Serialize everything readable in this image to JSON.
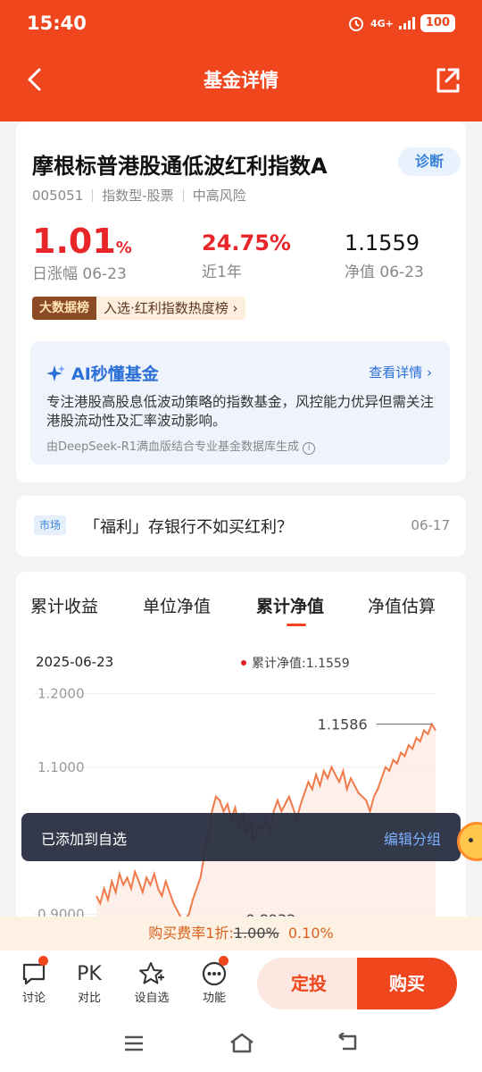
{
  "status": {
    "time": "15:40",
    "network": "4G+",
    "battery": "100"
  },
  "header": {
    "title": "基金详情"
  },
  "fund": {
    "name": "摩根标普港股通低波红利指数A",
    "diagnose_label": "诊断",
    "code": "005051",
    "type": "指数型-股票",
    "risk": "中高风险",
    "daily_change": "1.01",
    "daily_change_unit": "%",
    "daily_change_label": "日涨幅 06-23",
    "year_return": "24.75%",
    "year_return_label": "近1年",
    "nav": "1.1559",
    "nav_label": "净值 06-23",
    "rank_tag": "大数据榜",
    "rank_text": "入选·红利指数热度榜"
  },
  "ai": {
    "title": "AI秒懂基金",
    "more": "查看详情",
    "body": "专注港股高股息低波动策略的指数基金，风控能力优异但需关注港股流动性及汇率波动影响。",
    "footer": "由DeepSeek-R1满血版结合专业基金数据库生成"
  },
  "news": {
    "tag": "市场",
    "title": "「福利」存银行不如买红利？",
    "date": "06-17"
  },
  "tabs": [
    "累计收益",
    "单位净值",
    "累计净值",
    "净值估算"
  ],
  "active_tab": 2,
  "chart_meta": {
    "date": "2025-06-23",
    "legend": "累计净值:1.1559",
    "legend_color": "#e02020",
    "line_color": "#f07a4a"
  },
  "chart_data": {
    "type": "line",
    "ylim": [
      0.88,
      1.22
    ],
    "yticks": [
      "1.2000",
      "1.1000",
      "0.9000"
    ],
    "ytick_values": [
      1.2,
      1.1,
      0.9
    ],
    "series": [
      {
        "name": "累计净值",
        "values": [
          0.925,
          0.915,
          0.935,
          0.92,
          0.945,
          0.93,
          0.955,
          0.94,
          0.95,
          0.935,
          0.958,
          0.945,
          0.93,
          0.95,
          0.94,
          0.955,
          0.935,
          0.925,
          0.945,
          0.93,
          0.915,
          0.905,
          0.895,
          0.8932,
          0.9,
          0.92,
          0.935,
          0.95,
          0.98,
          1.01,
          1.04,
          1.06,
          1.055,
          1.04,
          1.05,
          1.03,
          1.045,
          1.02,
          1.035,
          1.01,
          1.03,
          1.0,
          1.02,
          1.015,
          1.03,
          1.01,
          1.04,
          1.055,
          1.04,
          1.05,
          1.06,
          1.045,
          1.03,
          1.05,
          1.065,
          1.08,
          1.07,
          1.09,
          1.075,
          1.095,
          1.085,
          1.1,
          1.09,
          1.08,
          1.095,
          1.07,
          1.085,
          1.075,
          1.065,
          1.06,
          1.055,
          1.04,
          1.06,
          1.07,
          1.085,
          1.1,
          1.095,
          1.11,
          1.105,
          1.12,
          1.115,
          1.13,
          1.125,
          1.14,
          1.135,
          1.15,
          1.145,
          1.1586,
          1.15
        ]
      }
    ],
    "annotations": [
      {
        "label": "1.1586",
        "value": 1.1586
      },
      {
        "label": "0.8932",
        "value": 0.8932
      }
    ]
  },
  "toast": {
    "message": "已添加到自选",
    "action": "编辑分组"
  },
  "fee": {
    "prefix": "购买费率1折:",
    "original": "1.00%",
    "discounted": "0.10%"
  },
  "bottom_nav": [
    {
      "label": "讨论",
      "icon": "chat-icon"
    },
    {
      "label": "对比",
      "icon": "pk-icon",
      "glyph": "PK"
    },
    {
      "label": "设自选",
      "icon": "star-add-icon"
    },
    {
      "label": "功能",
      "icon": "more-icon"
    }
  ],
  "actions": {
    "sip": "定投",
    "buy": "购买"
  }
}
